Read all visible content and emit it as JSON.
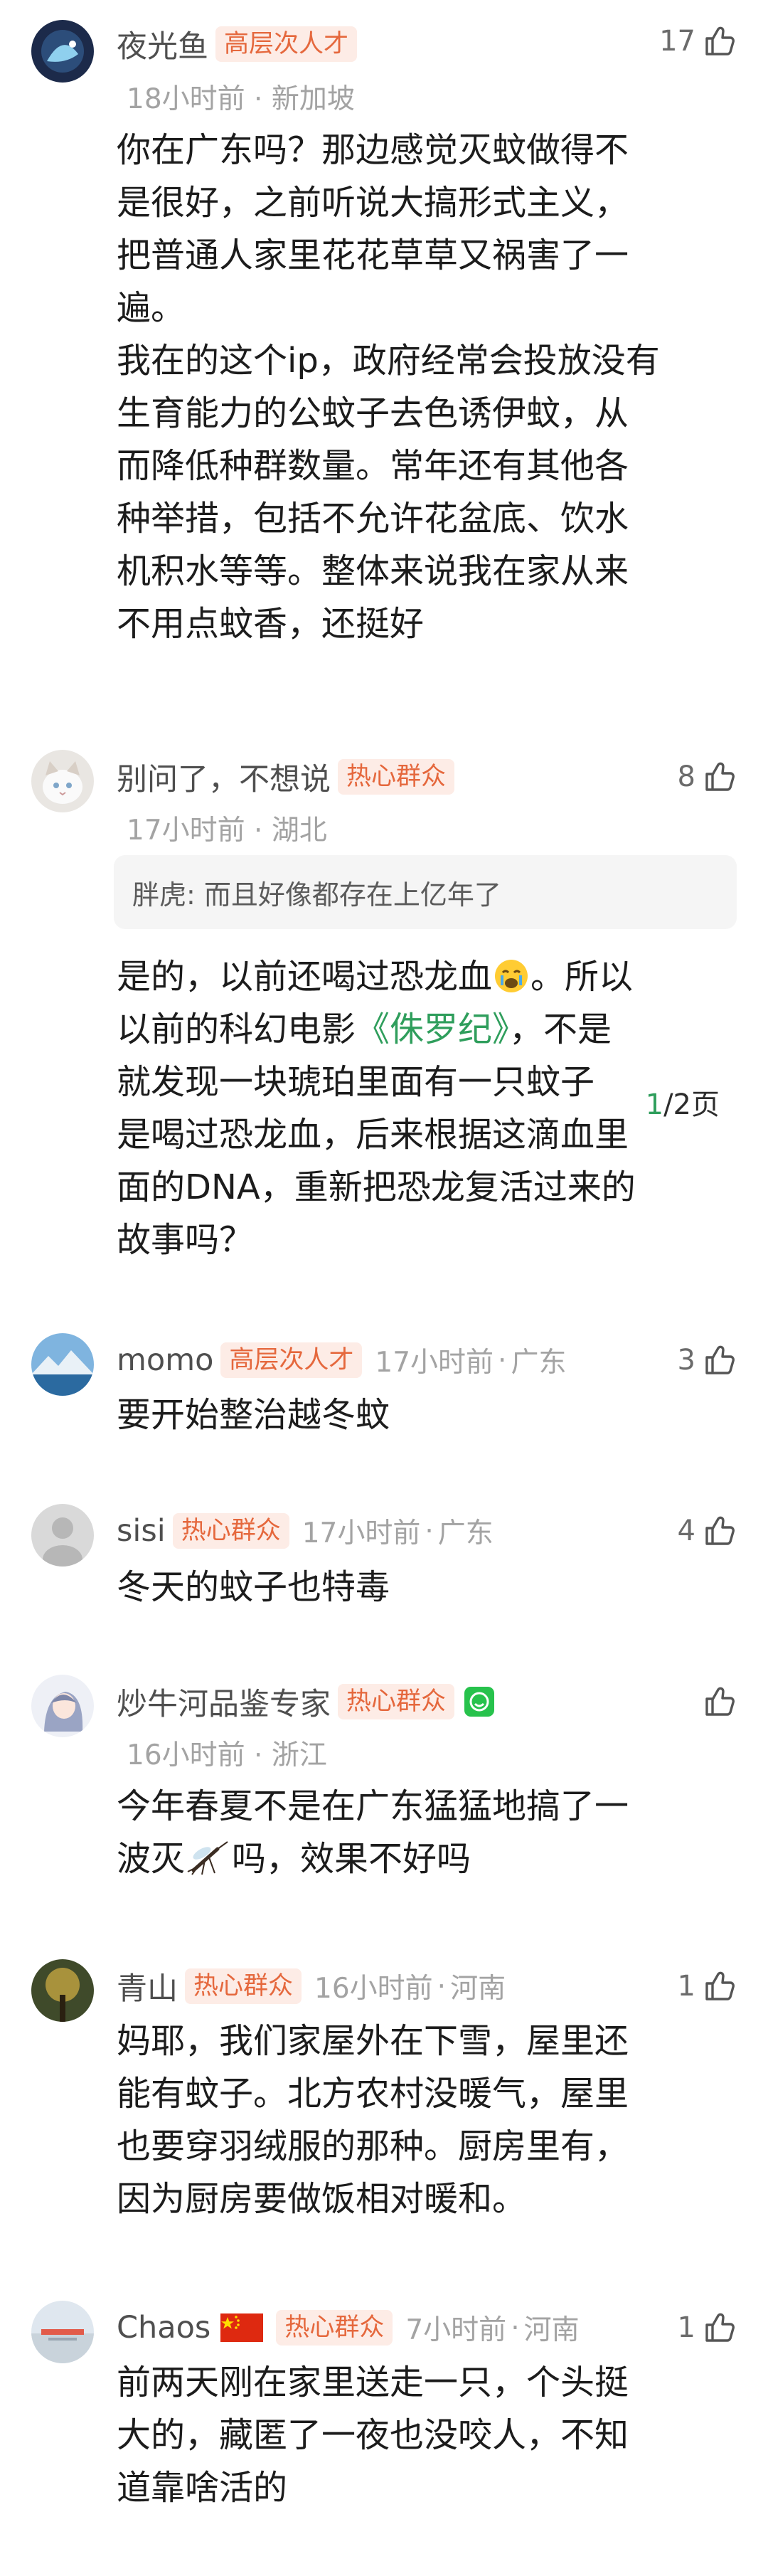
{
  "colors": {
    "badge_bg": "#fdece6",
    "badge_text": "#e5683d",
    "link": "#2f9e5c",
    "meta": "#a3a3a3"
  },
  "icons": {
    "like": "thumbs-up-icon",
    "badge_green": "green-smile-badge-icon",
    "flag": "china-flag-icon"
  },
  "comments": [
    {
      "user": "夜光鱼",
      "badge": "高层次人才",
      "time": "18小时前",
      "location": "新加坡",
      "likes": "17",
      "lines": [
        "你在广东吗？那边感觉灭蚊做得不",
        "是很好，之前听说大搞形式主义，",
        "把普通人家里花花草草又祸害了一",
        "遍。",
        "我在的这个ip，政府经常会投放没有",
        "生育能力的公蚊子去色诱伊蚊，从",
        "而降低种群数量。常年还有其他各",
        "种举措，包括不允许花盆底、饮水",
        "机积水等等。整体来说我在家从来",
        "不用点蚊香，还挺好"
      ]
    },
    {
      "user": "别问了，不想说",
      "badge": "热心群众",
      "time": "17小时前",
      "location": "湖北",
      "likes": "8",
      "quote": "胖虎: 而且好像都存在上亿年了",
      "line1_a": "是的，以前还喝过恐龙血",
      "line1_b": "。所以",
      "line2_a": "以前的科幻电影",
      "link": "《侏罗纪》",
      "line2_b": "，不是",
      "line3": "就发现一块琥珀里面有一只蚊子",
      "line4": "是喝过恐龙血，后来根据这滴血里",
      "line5": "面的DNA，重新把恐龙复活过来的",
      "line6": "故事吗？",
      "page_current": "1",
      "page_total": "/2页"
    },
    {
      "user": "momo",
      "badge": "高层次人才",
      "time": "17小时前",
      "location": "广东",
      "likes": "3",
      "text": "要开始整治越冬蚊"
    },
    {
      "user": "sisi",
      "badge": "热心群众",
      "time": "17小时前",
      "location": "广东",
      "likes": "4",
      "text": "冬天的蚊子也特毒"
    },
    {
      "user": "炒牛河品鉴专家",
      "badge": "热心群众",
      "time": "16小时前",
      "location": "浙江",
      "likes": "",
      "line1": "今年春夏不是在广东猛猛地搞了一",
      "line2_a": "波灭",
      "line2_b": "吗，效果不好吗"
    },
    {
      "user": "青山",
      "badge": "热心群众",
      "time": "16小时前",
      "location": "河南",
      "likes": "1",
      "lines": [
        "妈耶，我们家屋外在下雪，屋里还",
        "能有蚊子。北方农村没暖气，屋里",
        "也要穿羽绒服的那种。厨房里有，",
        "因为厨房要做饭相对暖和。"
      ]
    },
    {
      "user": "Chaos",
      "badge": "热心群众",
      "time": "7小时前",
      "location": "河南",
      "likes": "1",
      "lines": [
        "前两天刚在家里送走一只，个头挺",
        "大的，藏匿了一夜也没咬人，不知",
        "道靠啥活的"
      ]
    }
  ]
}
